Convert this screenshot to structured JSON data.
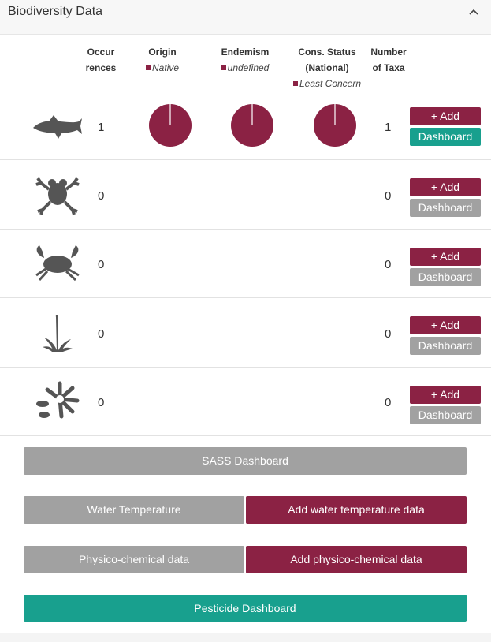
{
  "panel": {
    "title": "Biodiversity Data"
  },
  "headers": {
    "occurrences": [
      "Occur",
      "rences"
    ],
    "origin": {
      "label": "Origin",
      "legend": "Native"
    },
    "endemism": {
      "label": "Endemism",
      "legend": "undefined"
    },
    "cons_status": {
      "label": [
        "Cons. Status",
        "(National)"
      ],
      "legend": "Least Concern"
    },
    "taxa": [
      "Number",
      "of Taxa"
    ]
  },
  "colors": {
    "maroon": "#8b2244",
    "teal": "#18a08e",
    "grey": "#a1a1a1"
  },
  "rows": [
    {
      "icon": "fish-icon",
      "occurrences": "1",
      "taxa": "1",
      "has_charts": true,
      "pie_origin_fraction": 1.0,
      "pie_endemism_fraction": 1.0,
      "pie_cons_fraction": 1.0,
      "add_label": "+ Add",
      "dashboard_label": "Dashboard",
      "dashboard_active": true
    },
    {
      "icon": "frog-icon",
      "occurrences": "0",
      "taxa": "0",
      "has_charts": false,
      "add_label": "+ Add",
      "dashboard_label": "Dashboard",
      "dashboard_active": false
    },
    {
      "icon": "crab-icon",
      "occurrences": "0",
      "taxa": "0",
      "has_charts": false,
      "add_label": "+ Add",
      "dashboard_label": "Dashboard",
      "dashboard_active": false
    },
    {
      "icon": "reed-plant-icon",
      "occurrences": "0",
      "taxa": "0",
      "has_charts": false,
      "add_label": "+ Add",
      "dashboard_label": "Dashboard",
      "dashboard_active": false
    },
    {
      "icon": "diatom-icon",
      "occurrences": "0",
      "taxa": "0",
      "has_charts": false,
      "add_label": "+ Add",
      "dashboard_label": "Dashboard",
      "dashboard_active": false
    }
  ],
  "buttons": {
    "sass_dashboard": "SASS Dashboard",
    "water_temperature": "Water Temperature",
    "add_water_temperature": "Add water temperature data",
    "physico_chemical": "Physico-chemical data",
    "add_physico_chemical": "Add physico-chemical data",
    "pesticide_dashboard": "Pesticide Dashboard"
  }
}
